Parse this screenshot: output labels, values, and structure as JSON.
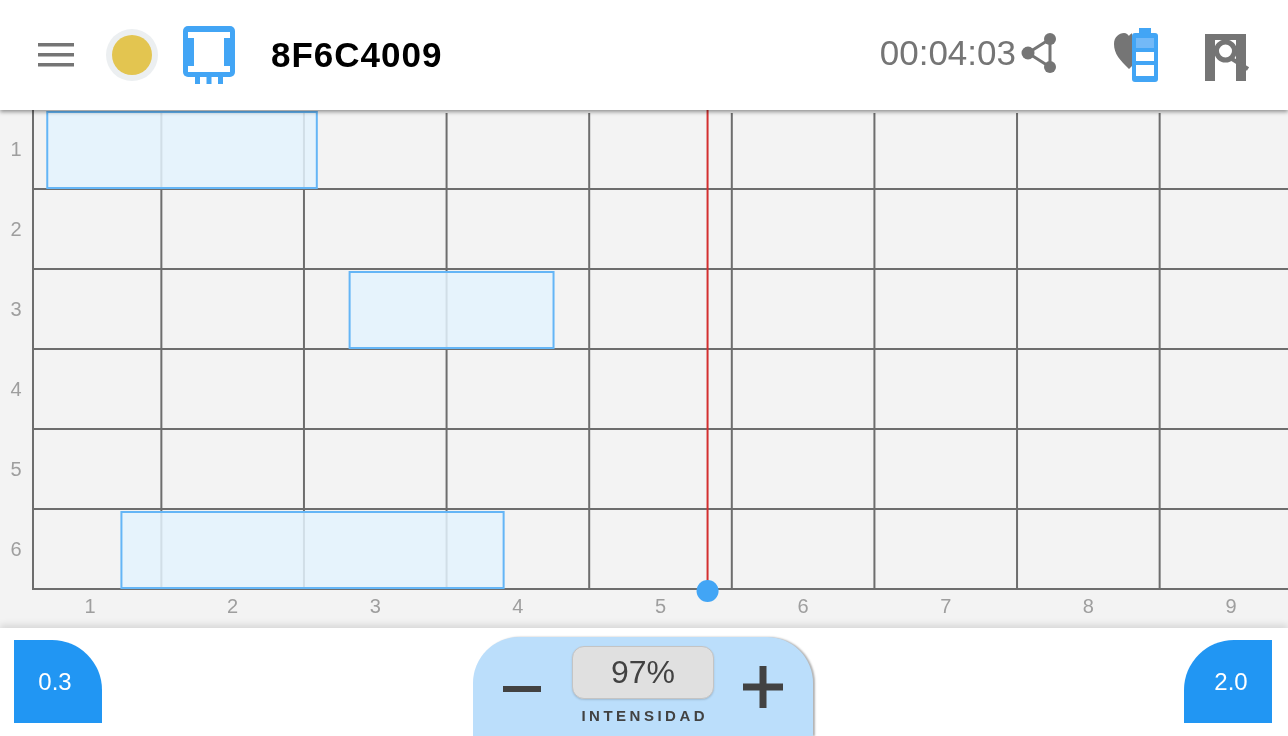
{
  "header": {
    "title": "8F6C4009",
    "timer": "00:04:03"
  },
  "timeline": {
    "chart_data": [
      {
        "type": "bar",
        "orientation": "horizontal",
        "categories": [
          "1",
          "2",
          "3",
          "4",
          "5",
          "6"
        ],
        "base": [
          0.7,
          null,
          2.82,
          null,
          null,
          1.22
        ],
        "values": [
          1.89,
          null,
          1.43,
          null,
          null,
          2.68
        ],
        "color": "#64b5f6",
        "xlim": [
          0.6,
          9.4
        ],
        "xticks": [
          1,
          2,
          3,
          4,
          5,
          6,
          7,
          8,
          9
        ],
        "grid": true,
        "ref_lines": [
          {
            "axis": "x",
            "value": 5.33,
            "color": "#d32f2f"
          }
        ]
      }
    ]
  },
  "footer": {
    "left_button": "0.3",
    "intensity": {
      "value": "97%",
      "label": "INTENSIDAD"
    },
    "right_button": "2.0"
  }
}
